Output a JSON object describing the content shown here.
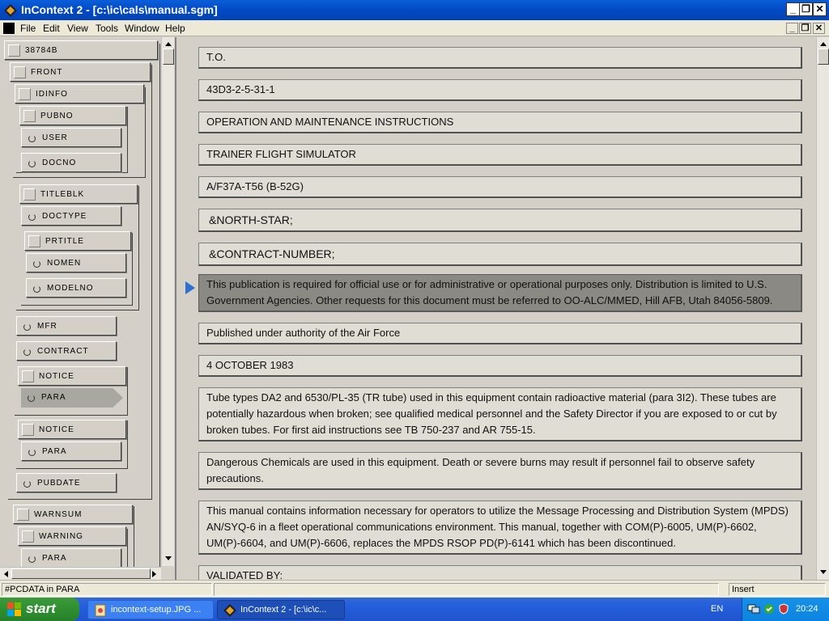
{
  "window": {
    "title": "InContext 2 - [c:\\ic\\cals\\manual.sgm]",
    "minimize": "_",
    "restore": "❐",
    "close": "✕"
  },
  "menu": {
    "items": [
      "File",
      "Edit",
      "View",
      "Tools",
      "Window",
      "Help"
    ]
  },
  "tree": {
    "nodes": [
      "38784B",
      "FRONT",
      "IDINFO",
      "PUBNO",
      "USER",
      "DOCNO",
      "TITLEBLK",
      "DOCTYPE",
      "PRTITLE",
      "NOMEN",
      "MODELNO",
      "MFR",
      "CONTRACT",
      "NOTICE",
      "PARA",
      "NOTICE",
      "PARA",
      "PUBDATE",
      "WARNSUM",
      "WARNING",
      "PARA"
    ]
  },
  "document": {
    "paras": [
      "T.O.",
      "43D3-2-5-31-1",
      "OPERATION AND MAINTENANCE INSTRUCTIONS",
      "TRAINER FLIGHT SIMULATOR",
      "A/F37A-T56 (B-52G)",
      "&NORTH-STAR;",
      "&CONTRACT-NUMBER;",
      "This publication is required for official use or for administrative or operational purposes only. Distribution is limited to U.S. Government Agencies. Other requests for this document must be referred to OO-ALC/MMED, Hill AFB, Utah 84056-5809.",
      "Published under authority of the Air Force",
      "4 OCTOBER 1983",
      "Tube types DA2 and 6530/PL-35 (TR tube) used in this equipment contain radioactive material (para 3I2). These tubes are potentially hazardous when broken; see qualified medical personnel and the Safety Director if you are exposed to or cut by broken tubes. For first aid instructions see TB 750-237 and AR 755-15.",
      "Dangerous Chemicals are used in this equipment. Death or severe burns may result if personnel fail to observe safety precautions.",
      "This manual contains information necessary for operators to utilize the Message Processing and Distribution System (MPDS) AN/SYQ-6 in a fleet operational communications environment. This manual, together with COM(P)-6005, UM(P)-6602, UM(P)-6604, and UM(P)-6606, replaces the MPDS RSOP PD(P)-6141 which has been discontinued.",
      "VALIDATED BY:"
    ]
  },
  "status": {
    "context": "#PCDATA in PARA",
    "mode": "Insert"
  },
  "taskbar": {
    "start": "start",
    "tasks": [
      "incontext-setup.JPG ...",
      "InContext 2 - [c:\\ic\\c..."
    ],
    "lang": "EN",
    "clock": "20:24"
  }
}
